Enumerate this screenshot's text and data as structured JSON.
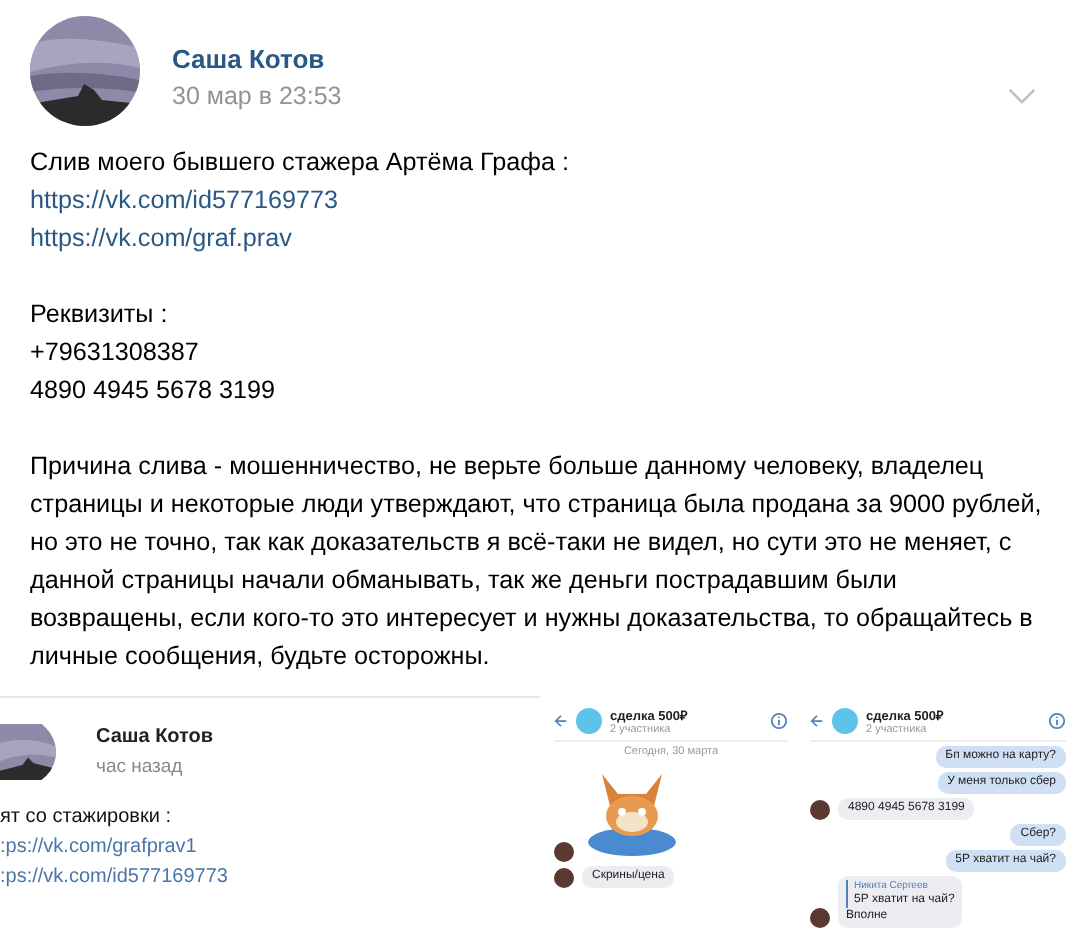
{
  "post": {
    "author": "Саша Котов",
    "date": "30 мар в 23:53",
    "body": [
      {
        "kind": "text",
        "text": "Слив моего бывшего стажера Артёма Графа :"
      },
      {
        "kind": "link",
        "text": "https://vk.com/id577169773"
      },
      {
        "kind": "link",
        "text": "https://vk.com/graf.prav"
      },
      {
        "kind": "gap"
      },
      {
        "kind": "text",
        "text": "Реквизиты :"
      },
      {
        "kind": "text",
        "text": "+79631308387"
      },
      {
        "kind": "text",
        "text": "4890 4945 5678 3199"
      },
      {
        "kind": "gap"
      },
      {
        "kind": "text",
        "text": "Причина слива - мошенничество, не верьте больше данному человеку, владелец страницы и некоторые люди утверждают, что страница была продана за 9000 рублей, но это не точно, так как доказательств я всё-таки не видел, но сути это не меняет, с данной страницы начали обманывать, так же деньги пострадавшим были возвращены, если кого-то это интересует и нужны доказательства, то обращайтесь в личные сообщения, будьте осторожны."
      }
    ]
  },
  "attachments": [
    {
      "kind": "post_screenshot",
      "author": "Саша Котов",
      "time": "час назад",
      "lines": [
        {
          "kind": "text",
          "text": "ят со стажировки :"
        },
        {
          "kind": "link",
          "text": ":ps://vk.com/grafprav1"
        },
        {
          "kind": "link",
          "text": ":ps://vk.com/id577169773"
        }
      ]
    },
    {
      "kind": "chat_screenshot",
      "chat_title": "сделка 500₽",
      "members": "2 участника",
      "date_divider": "Сегодня, 30 марта",
      "messages": [
        {
          "kind": "sticker",
          "outgoing": false
        },
        {
          "kind": "text",
          "outgoing": false,
          "text": "Скрины/цена"
        }
      ]
    },
    {
      "kind": "chat_screenshot",
      "chat_title": "сделка 500₽",
      "members": "2 участника",
      "messages": [
        {
          "kind": "text",
          "outgoing": true,
          "text": "Бп можно на карту?"
        },
        {
          "kind": "text",
          "outgoing": true,
          "text": "У меня только сбер"
        },
        {
          "kind": "text",
          "outgoing": false,
          "text": "4890 4945 5678 3199"
        },
        {
          "kind": "text",
          "outgoing": true,
          "text": "Сбер?"
        },
        {
          "kind": "text",
          "outgoing": true,
          "text": "5Р хватит на чай?"
        },
        {
          "kind": "reply",
          "outgoing": false,
          "quote_author": "Никита Сергеев",
          "quote_text": "5Р хватит на чай?",
          "text": "Вполне"
        }
      ]
    }
  ]
}
